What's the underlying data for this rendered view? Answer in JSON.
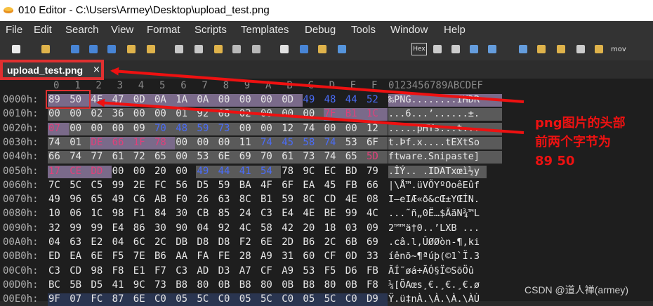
{
  "window": {
    "title": "010 Editor - C:\\Users\\Armey\\Desktop\\upload_test.png"
  },
  "menu": [
    "File",
    "Edit",
    "Search",
    "View",
    "Format",
    "Scripts",
    "Templates",
    "Debug",
    "Tools",
    "Window",
    "Help"
  ],
  "toolbar": {
    "icons": [
      "new-file-icon",
      "open-folder-icon",
      "save-icon",
      "save-as-icon",
      "copy-file-icon",
      "folder-icon",
      "folder-open-icon",
      "cut-icon",
      "copy-icon",
      "paste-icon",
      "undo-icon",
      "redo-icon",
      "find-icon",
      "replace-icon",
      "find-in-files-icon",
      "goto-icon",
      "hex-view-icon",
      "columns-icon",
      "paragraph-icon",
      "table-icon",
      "list-icon",
      "calculator-icon",
      "compare-icon",
      "histogram-icon",
      "percent-icon",
      "checksum-icon",
      "move-icon"
    ],
    "hex_label": "Hex",
    "mov_label": "mov"
  },
  "tab": {
    "label": "upload_test.png",
    "close": "×"
  },
  "editor": {
    "column_headers": [
      "0",
      "1",
      "2",
      "3",
      "4",
      "5",
      "6",
      "7",
      "8",
      "9",
      "A",
      "B",
      "C",
      "D",
      "E",
      "F"
    ],
    "ascii_header": "0123456789ABCDEF",
    "rows": [
      {
        "addr": "0000h:",
        "bytes": [
          "89",
          "50",
          "4E",
          "47",
          "0D",
          "0A",
          "1A",
          "0A",
          "00",
          "00",
          "00",
          "0D",
          "49",
          "48",
          "44",
          "52"
        ],
        "ascii": "‰PNG........IHDR"
      },
      {
        "addr": "0010h:",
        "bytes": [
          "00",
          "00",
          "02",
          "36",
          "00",
          "00",
          "01",
          "92",
          "08",
          "02",
          "00",
          "00",
          "00",
          "7F",
          "B1",
          "1C"
        ],
        "ascii": "...6...’......±."
      },
      {
        "addr": "0020h:",
        "bytes": [
          "07",
          "00",
          "00",
          "00",
          "09",
          "70",
          "48",
          "59",
          "73",
          "00",
          "00",
          "12",
          "74",
          "00",
          "00",
          "12"
        ],
        "ascii": ".....pHYs...t..."
      },
      {
        "addr": "0030h:",
        "bytes": [
          "74",
          "01",
          "DE",
          "66",
          "1F",
          "78",
          "00",
          "00",
          "00",
          "11",
          "74",
          "45",
          "58",
          "74",
          "53",
          "6F"
        ],
        "ascii": "t.Þf.x....tEXtSo"
      },
      {
        "addr": "0040h:",
        "bytes": [
          "66",
          "74",
          "77",
          "61",
          "72",
          "65",
          "00",
          "53",
          "6E",
          "69",
          "70",
          "61",
          "73",
          "74",
          "65",
          "5D"
        ],
        "ascii": "ftware.Snipaste]"
      },
      {
        "addr": "0050h:",
        "bytes": [
          "17",
          "CE",
          "DD",
          "00",
          "00",
          "20",
          "00",
          "49",
          "44",
          "41",
          "54",
          "78",
          "9C",
          "EC",
          "BD",
          "79"
        ],
        "ascii": ".ÎÝ.. .IDATxœì½y"
      },
      {
        "addr": "0060h:",
        "bytes": [
          "7C",
          "5C",
          "C5",
          "99",
          "2E",
          "FC",
          "56",
          "D5",
          "59",
          "BA",
          "4F",
          "6F",
          "EA",
          "45",
          "FB",
          "66"
        ],
        "ascii": "|\\Å™.üVÕYºOoêEûf"
      },
      {
        "addr": "0070h:",
        "bytes": [
          "49",
          "96",
          "65",
          "49",
          "C6",
          "AB",
          "F0",
          "26",
          "63",
          "8C",
          "B1",
          "59",
          "8C",
          "CD",
          "4E",
          "08"
        ],
        "ascii": "I–eIÆ«ð&cŒ±YŒÍN."
      },
      {
        "addr": "0080h:",
        "bytes": [
          "10",
          "06",
          "1C",
          "98",
          "F1",
          "84",
          "30",
          "CB",
          "85",
          "24",
          "C3",
          "E4",
          "4E",
          "BE",
          "99",
          "4C"
        ],
        "ascii": "...˜ñ„0Ë…$ÃäN¾™L"
      },
      {
        "addr": "0090h:",
        "bytes": [
          "32",
          "99",
          "99",
          "E4",
          "86",
          "30",
          "90",
          "04",
          "92",
          "4C",
          "58",
          "42",
          "20",
          "18",
          "03",
          "09"
        ],
        "ascii": "2™™ä†0..’LXB ..."
      },
      {
        "addr": "00A0h:",
        "bytes": [
          "04",
          "63",
          "E2",
          "04",
          "6C",
          "2C",
          "DB",
          "D8",
          "D8",
          "F2",
          "6E",
          "2D",
          "B6",
          "2C",
          "6B",
          "69"
        ],
        "ascii": ".câ.l,ÛØØòn-¶,ki"
      },
      {
        "addr": "00B0h:",
        "bytes": [
          "ED",
          "EA",
          "6E",
          "F5",
          "7E",
          "B6",
          "AA",
          "FA",
          "FE",
          "28",
          "A9",
          "31",
          "60",
          "CF",
          "0D",
          "33"
        ],
        "ascii": "íênõ~¶ªúþ(©1`Ï.3"
      },
      {
        "addr": "00C0h:",
        "bytes": [
          "C3",
          "CD",
          "98",
          "F8",
          "E1",
          "F7",
          "C3",
          "AD",
          "D3",
          "A7",
          "CF",
          "A9",
          "53",
          "F5",
          "D6",
          "FB"
        ],
        "ascii": "ÃÍ˜øá÷Ã­Ó§Ï©SõÖû"
      },
      {
        "addr": "00D0h:",
        "bytes": [
          "BC",
          "5B",
          "D5",
          "41",
          "9C",
          "73",
          "B8",
          "80",
          "0B",
          "B8",
          "80",
          "0B",
          "B8",
          "80",
          "0B",
          "F8"
        ],
        "ascii": "¼[ÕAœs¸€.¸€.¸€.ø"
      },
      {
        "addr": "00E0h:",
        "bytes": [
          "9F",
          "07",
          "FC",
          "87",
          "6E",
          "C0",
          "05",
          "5C",
          "C0",
          "05",
          "5C",
          "C0",
          "05",
          "5C",
          "C0",
          "D9"
        ],
        "ascii": "Ÿ.ü‡nÀ.\\À.\\À.\\ÀÙ"
      }
    ]
  },
  "annotation": {
    "lines": [
      "png图片的头部",
      "前两个字节为",
      "89 50"
    ]
  },
  "watermark": "CSDN @道人禅(armey)",
  "colors": {
    "annotation": "#ee1111",
    "highlight_purple": "#7a6a8a",
    "highlight_grey": "#5a5a5a",
    "blue_text": "#4a6cf7",
    "red_text": "#e0407a"
  }
}
